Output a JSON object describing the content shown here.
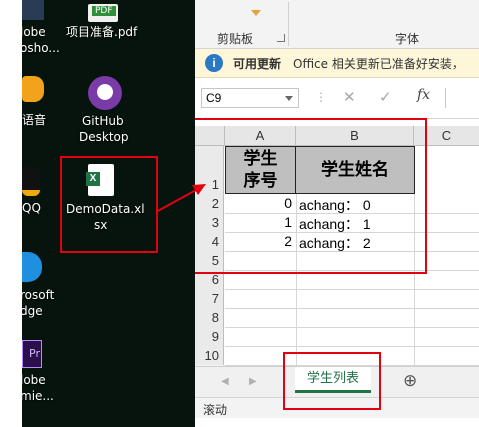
{
  "desktop": {
    "top_icon_left_label_1": "lobe",
    "top_icon_left_label_2": "osho...",
    "pdf_file_label": "项目准备.pdf",
    "pdf_badge": "PDF",
    "left_icon2_label": "语音",
    "github_label_1": "GitHub",
    "github_label_2": "Desktop",
    "qq_label": "QQ",
    "xlsx_label_1": "DemoData.xl",
    "xlsx_label_2": "sx",
    "edge_label_1": "rosoft",
    "edge_label_2": "dge",
    "premiere_label_1": "lobe",
    "premiere_label_2": "mie..."
  },
  "excel": {
    "ribbon": {
      "clipboard_label": "剪贴板",
      "font_label": "字体"
    },
    "update_bar": {
      "title": "可用更新",
      "message": "Office 相关更新已准备好安装，"
    },
    "name_box": "C9",
    "fx_label": "fx",
    "columns": [
      "A",
      "B",
      "C"
    ],
    "rows": [
      "1",
      "2",
      "3",
      "4",
      "5",
      "6",
      "7",
      "8",
      "9",
      "10"
    ],
    "header_cells": {
      "a1": "学生序号",
      "b1": "学生姓名"
    },
    "data_rows": [
      {
        "id": "0",
        "name": "achang： 0"
      },
      {
        "id": "1",
        "name": "achang： 1"
      },
      {
        "id": "2",
        "name": "achang： 2"
      }
    ],
    "sheet_tab": "学生列表",
    "add_sheet": "⊕",
    "status": "滚动",
    "colors": {
      "header_fill": "#bfbfbf",
      "tab_green": "#217346",
      "red_annotation": "#e3000f",
      "info_blue": "#2b78c5"
    }
  }
}
